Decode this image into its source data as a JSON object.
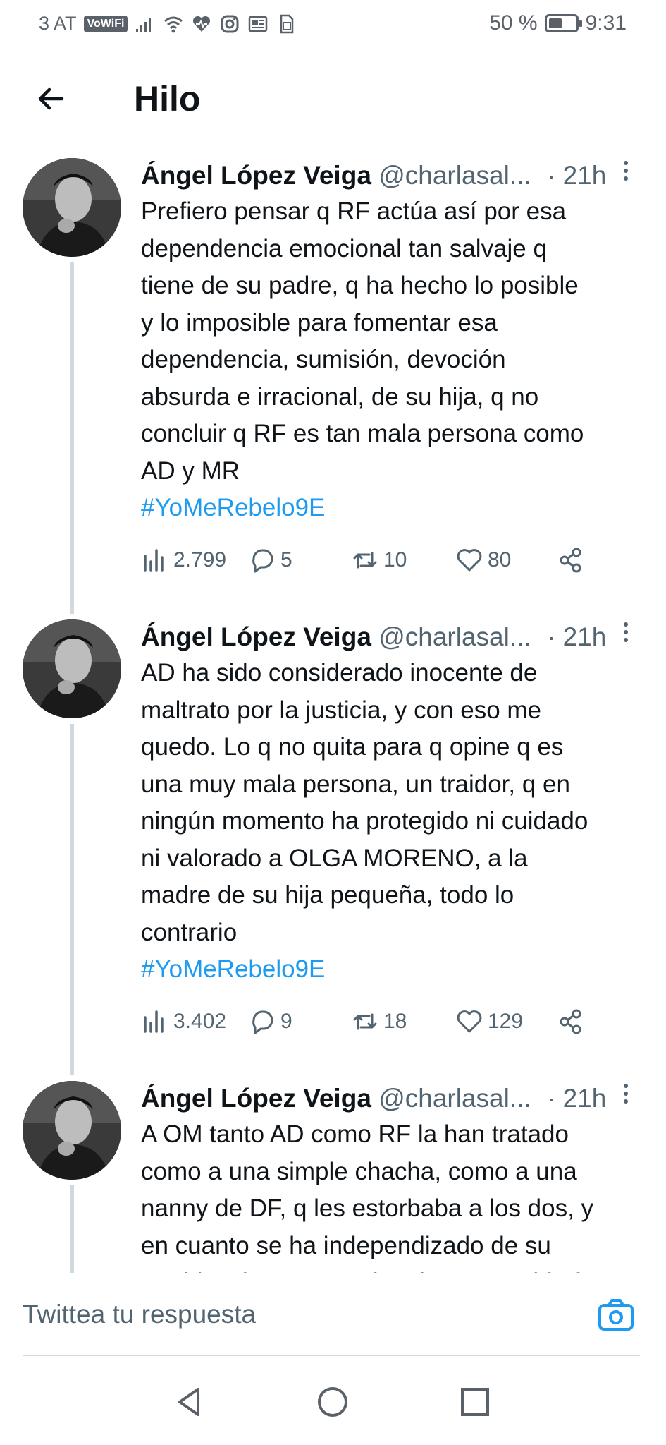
{
  "status_bar": {
    "carrier": "3 AT",
    "vowifi": "VoWiFi",
    "battery_percent": "50 %",
    "battery_level": 0.5,
    "time": "9:31",
    "icons": [
      "signal-icon",
      "wifi-icon",
      "health-icon",
      "instagram-icon",
      "news-icon",
      "sim-icon"
    ]
  },
  "header": {
    "back_icon": "arrow-left-icon",
    "title": "Hilo"
  },
  "tweets": [
    {
      "name": "Ángel López Veiga",
      "handle": "@charlasal...",
      "time": "· 21h",
      "text": "Prefiero pensar q RF actúa así por esa\ndependencia emocional tan salvaje q\ntiene de su padre, q ha hecho lo posible\ny lo imposible para fomentar esa\ndependencia, sumisión, devoción\nabsurda e irracional, de su hija, q no\nconcluir q RF es tan mala persona como\nAD y MR",
      "hashtag": "#YoMeRebelo9E",
      "views": "2.799",
      "replies": "5",
      "retweets": "10",
      "likes": "80"
    },
    {
      "name": "Ángel López Veiga",
      "handle": "@charlasal...",
      "time": "· 21h",
      "text": "AD ha sido considerado inocente de\nmaltrato por la justicia, y con eso me\nquedo. Lo q no quita para q opine q es\nuna muy mala persona, un traidor, q en\nningún momento ha protegido ni cuidado\nni valorado a OLGA MORENO, a la\nmadre de su hija pequeña, todo lo\ncontrario",
      "hashtag": "#YoMeRebelo9E",
      "views": "3.402",
      "replies": "9",
      "retweets": "18",
      "likes": "129"
    },
    {
      "name": "Ángel López Veiga",
      "handle": "@charlasal...",
      "time": "· 21h",
      "text": "A OM tanto AD como RF la han tratado\ncomo a una simple chacha, como a una\nnanny de DF, q les estorbaba a los dos, y\nen cuanto se ha independizado de su\nmarido y ha empezado a hacer su vida fuera",
      "hashtag": "",
      "views": "",
      "replies": "",
      "retweets": "",
      "likes": ""
    }
  ],
  "reply": {
    "placeholder": "Twittea tu respuesta",
    "camera_icon": "camera-icon"
  },
  "navigation": {
    "back": "nav-back-icon",
    "home": "nav-home-icon",
    "recents": "nav-recents-icon"
  },
  "colors": {
    "link": "#1d9bf0",
    "secondary_text": "#536471",
    "primary_text": "#0f1419"
  }
}
